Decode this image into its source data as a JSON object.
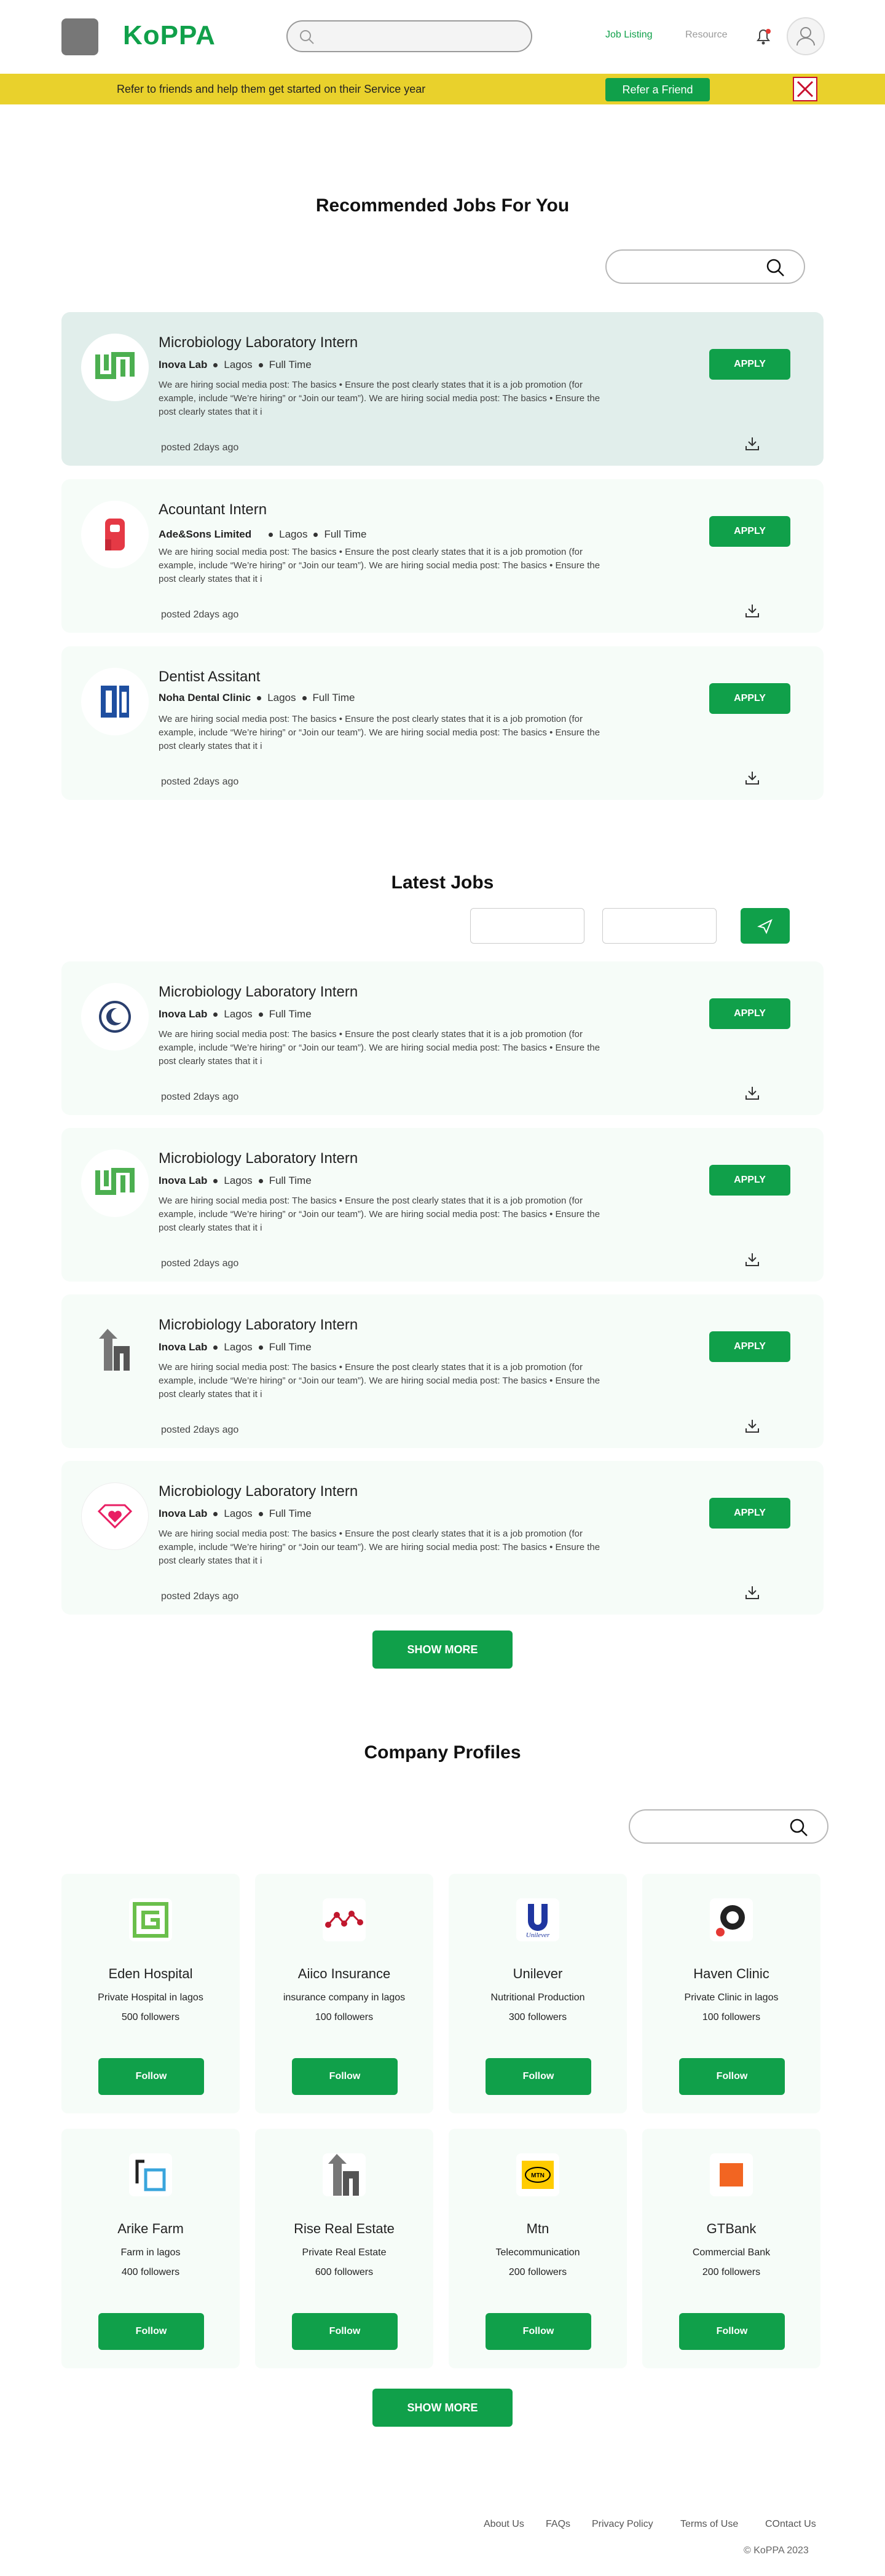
{
  "header": {
    "brand": "KoPPA",
    "search_placeholder": "",
    "nav": [
      "Job Listing",
      "Resource"
    ]
  },
  "banner": {
    "text": "Refer to friends and help them get started on their Service year",
    "button": "Refer a Friend"
  },
  "recommended": {
    "title": "Recommended Jobs For You",
    "jobs": [
      {
        "title": "Microbiology Laboratory Intern",
        "company": "Inova Lab",
        "location": "Lagos",
        "type": "Full Time",
        "desc": "We are hiring social media post: The basics • Ensure the post clearly states that it is a job promotion (for example, include “We’re hiring” or “Join our team”). We are hiring social media post: The basics • Ensure the post clearly states that it i",
        "posted": "posted 2days ago",
        "apply": "APPLY"
      },
      {
        "title": "Acountant Intern",
        "company": "Ade&Sons Limited",
        "location": "Lagos",
        "type": "Full Time",
        "desc": "We are hiring social media post: The basics • Ensure the post clearly states that it is a job promotion (for example, include “We’re hiring” or “Join our team”). We are hiring social media post: The basics • Ensure the post clearly states that it i",
        "posted": "posted 2days ago",
        "apply": "APPLY"
      },
      {
        "title": "Dentist Assitant",
        "company": "Noha Dental Clinic",
        "location": "Lagos",
        "type": "Full Time",
        "desc": "We are hiring social media post: The basics • Ensure the post clearly states that it is a job promotion (for example, include “We’re hiring” or “Join our team”). We are hiring social media post: The basics • Ensure the post clearly states that it i",
        "posted": "posted 2days ago",
        "apply": "APPLY"
      }
    ]
  },
  "latest": {
    "title": "Latest Jobs",
    "jobs": [
      {
        "title": "Microbiology Laboratory Intern",
        "company": "Inova Lab",
        "location": "Lagos",
        "type": "Full Time",
        "desc": "We are hiring social media post: The basics • Ensure the post clearly states that it is a job promotion (for example, include “We’re hiring” or “Join our team”). We are hiring social media post: The basics • Ensure the post clearly states that it i",
        "posted": "posted 2days ago",
        "apply": "APPLY"
      },
      {
        "title": "Microbiology Laboratory Intern",
        "company": "Inova Lab",
        "location": "Lagos",
        "type": "Full Time",
        "desc": "We are hiring social media post: The basics • Ensure the post clearly states that it is a job promotion (for example, include “We’re hiring” or “Join our team”). We are hiring social media post: The basics • Ensure the post clearly states that it i",
        "posted": "posted 2days ago",
        "apply": "APPLY"
      },
      {
        "title": "Microbiology Laboratory Intern",
        "company": "Inova Lab",
        "location": "Lagos",
        "type": "Full Time",
        "desc": "We are hiring social media post: The basics • Ensure the post clearly states that it is a job promotion (for example, include “We’re hiring” or “Join our team”). We are hiring social media post: The basics • Ensure the post clearly states that it i",
        "posted": "posted 2days ago",
        "apply": "APPLY"
      },
      {
        "title": "Microbiology Laboratory Intern",
        "company": "Inova Lab",
        "location": "Lagos",
        "type": "Full Time",
        "desc": "We are hiring social media post: The basics • Ensure the post clearly states that it is a job promotion (for example, include “We’re hiring” or “Join our team”). We are hiring social media post: The basics • Ensure the post clearly states that it i",
        "posted": "posted 2days ago",
        "apply": "APPLY"
      }
    ],
    "show_more": "SHOW MORE"
  },
  "companies": {
    "title": "Company Profiles",
    "items": [
      {
        "name": "Eden Hospital",
        "type": "Private Hospital in lagos",
        "followers": "500 followers",
        "follow": "Follow"
      },
      {
        "name": "Aiico Insurance",
        "type": "insurance company in lagos",
        "followers": "100 followers",
        "follow": "Follow"
      },
      {
        "name": "Unilever",
        "type": "Nutritional Production",
        "followers": "300 followers",
        "follow": "Follow"
      },
      {
        "name": "Haven Clinic",
        "type": "Private Clinic in lagos",
        "followers": "100 followers",
        "follow": "Follow"
      },
      {
        "name": "Arike Farm",
        "type": "Farm in lagos",
        "followers": "400 followers",
        "follow": "Follow"
      },
      {
        "name": "Rise Real Estate",
        "type": "Private Real Estate",
        "followers": "600 followers",
        "follow": "Follow"
      },
      {
        "name": "Mtn",
        "type": "Telecommunication",
        "followers": "200 followers",
        "follow": "Follow"
      },
      {
        "name": "GTBank",
        "type": "Commercial Bank",
        "followers": "200 followers",
        "follow": "Follow"
      }
    ],
    "show_more": "SHOW MORE",
    "logo_text": {
      "unilever": "Unilever",
      "mtn": "MTN"
    }
  },
  "footer": {
    "links": [
      "About Us",
      "FAQs",
      "Privacy Policy",
      "Terms of Use",
      "COntact Us"
    ],
    "copyright": "© KoPPA 2023"
  },
  "colors": {
    "brand_green": "#10a04a",
    "banner_yellow": "#e9d12c",
    "card_bg": "#f6fcf8",
    "highlight_card": "#e1eeeb"
  }
}
